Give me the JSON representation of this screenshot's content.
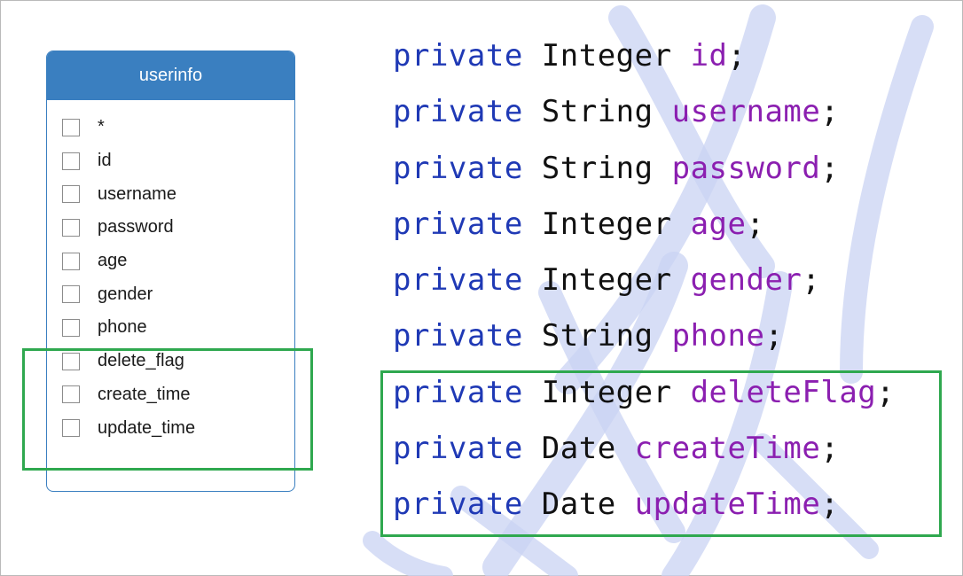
{
  "colors": {
    "table_header_bg": "#3a7fc0",
    "highlight_border": "#2fa84f",
    "keyword": "#1f39b5",
    "field_name": "#8b1fb0",
    "type": "#111111"
  },
  "table": {
    "name": "userinfo",
    "fields": [
      "*",
      "id",
      "username",
      "password",
      "age",
      "gender",
      "phone",
      "delete_flag",
      "create_time",
      "update_time"
    ]
  },
  "code": {
    "lines": [
      {
        "modifier": "private",
        "type": "Integer",
        "name": "id",
        "end": ";"
      },
      {
        "modifier": "private",
        "type": "String",
        "name": "username",
        "end": ";"
      },
      {
        "modifier": "private",
        "type": "String",
        "name": "password",
        "end": ";"
      },
      {
        "modifier": "private",
        "type": "Integer",
        "name": "age",
        "end": ";"
      },
      {
        "modifier": "private",
        "type": "Integer",
        "name": "gender",
        "end": ";"
      },
      {
        "modifier": "private",
        "type": "String",
        "name": "phone",
        "end": ";"
      },
      {
        "modifier": "private",
        "type": "Integer",
        "name": "deleteFlag",
        "end": ";"
      },
      {
        "modifier": "private",
        "type": "Date",
        "name": "createTime",
        "end": ";"
      },
      {
        "modifier": "private",
        "type": "Date",
        "name": "updateTime",
        "end": ";"
      }
    ]
  }
}
